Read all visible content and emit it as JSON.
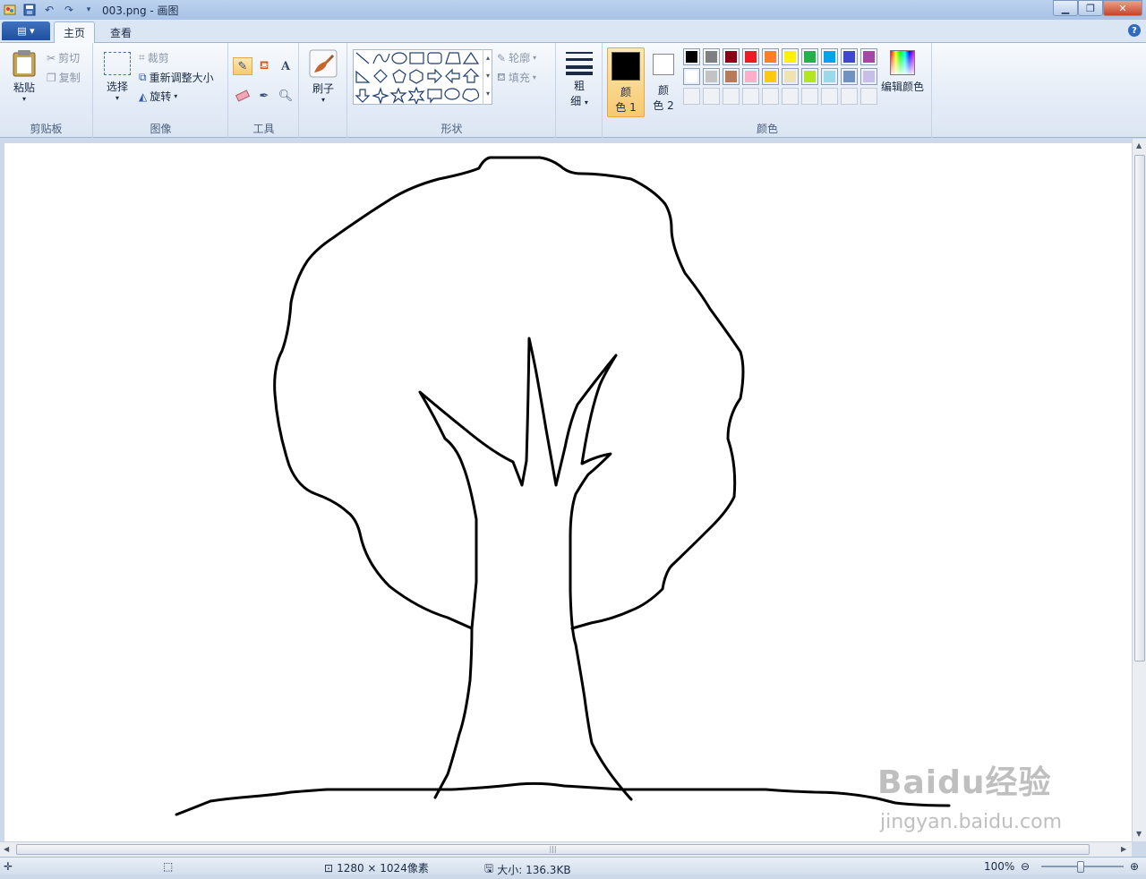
{
  "window": {
    "title": "003.png - 画图"
  },
  "tabs": [
    {
      "label": "主页",
      "active": true
    },
    {
      "label": "查看",
      "active": false
    }
  ],
  "clipboard": {
    "paste": "粘贴",
    "cut": "剪切",
    "copy": "复制",
    "group": "剪贴板"
  },
  "image": {
    "select": "选择",
    "crop": "裁剪",
    "resize": "重新调整大小",
    "rotate": "旋转",
    "group": "图像"
  },
  "tools": {
    "group": "工具",
    "selected": "pencil"
  },
  "brush": {
    "label": "刷子"
  },
  "shapes": {
    "outline": "轮廓",
    "fill": "填充",
    "group": "形状"
  },
  "size": {
    "label_top": "粗",
    "label_bottom": "细"
  },
  "colors": {
    "color1_top": "颜",
    "color1_bottom": "色 1",
    "color2_top": "颜",
    "color2_bottom": "色 2",
    "edit": "编辑颜色",
    "group": "颜色",
    "color1_value": "#000000",
    "color2_value": "#ffffff",
    "palette_row1": [
      "#000000",
      "#7f7f7f",
      "#880015",
      "#ed1c24",
      "#ff7f27",
      "#fff200",
      "#22b14c",
      "#00a2e8",
      "#3f48cc",
      "#a349a4"
    ],
    "palette_row2": [
      "#ffffff",
      "#c3c3c3",
      "#b97a57",
      "#ffaec9",
      "#ffc90e",
      "#efe4b0",
      "#b5e61d",
      "#99d9ea",
      "#7092be",
      "#c8bfe7"
    ]
  },
  "status": {
    "dimensions": "1280 × 1024像素",
    "size": "大小: 136.3KB",
    "zoom": "100%"
  },
  "watermark": {
    "logo": "Baidu经验",
    "url": "jingyan.baidu.com"
  }
}
